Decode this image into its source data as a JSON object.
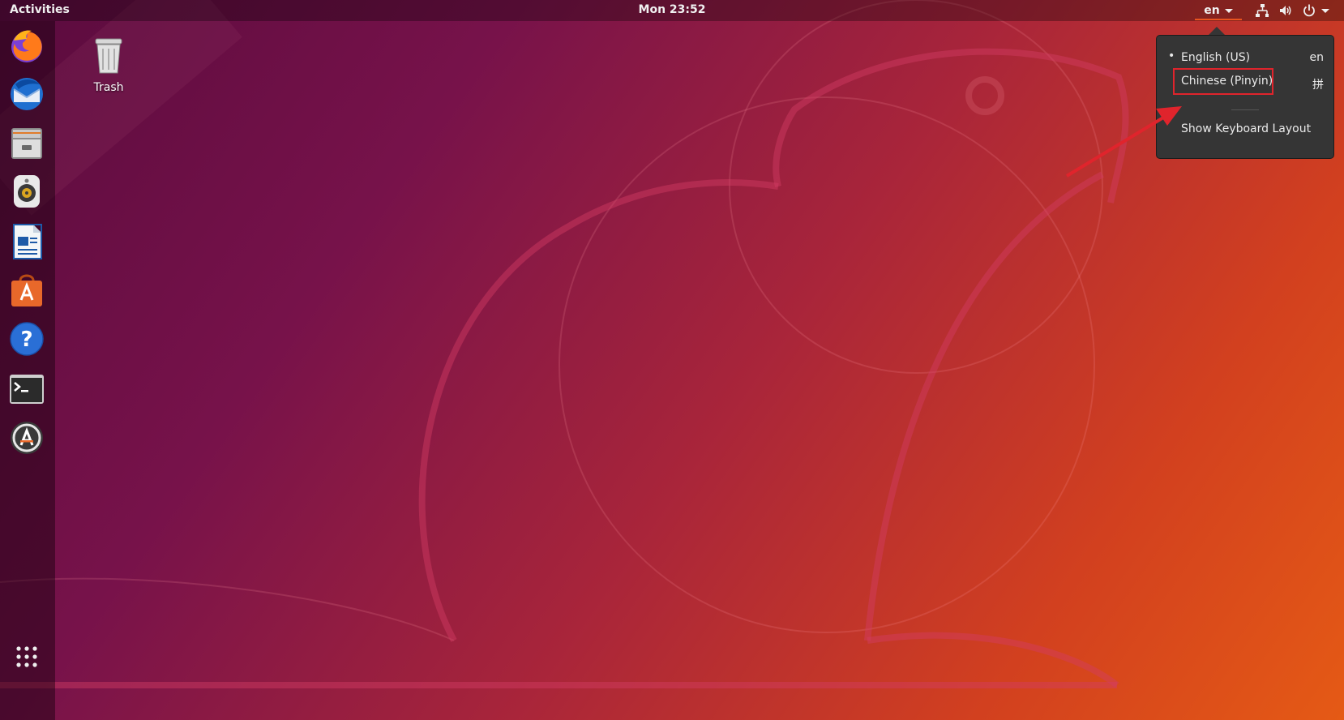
{
  "topbar": {
    "activities": "Activities",
    "clock": "Mon 23:52",
    "input_indicator": "en"
  },
  "dock": {
    "items": [
      {
        "name": "firefox-icon"
      },
      {
        "name": "thunderbird-icon"
      },
      {
        "name": "files-icon"
      },
      {
        "name": "rhythmbox-icon"
      },
      {
        "name": "writer-icon"
      },
      {
        "name": "software-icon"
      },
      {
        "name": "help-icon"
      },
      {
        "name": "terminal-icon"
      },
      {
        "name": "updater-icon"
      },
      {
        "name": "app-grid-icon"
      }
    ]
  },
  "desktop": {
    "trash_label": "Trash"
  },
  "menu": {
    "items": [
      {
        "label": "English (US)",
        "code": "en",
        "active": true
      },
      {
        "label": "Chinese (Pinyin)",
        "code": "拼",
        "active": false
      }
    ],
    "bullet": "•",
    "show_layout": "Show Keyboard Layout"
  },
  "colors": {
    "accent": "#e95420",
    "annotation": "#e0242c",
    "menu_bg": "#353535"
  }
}
